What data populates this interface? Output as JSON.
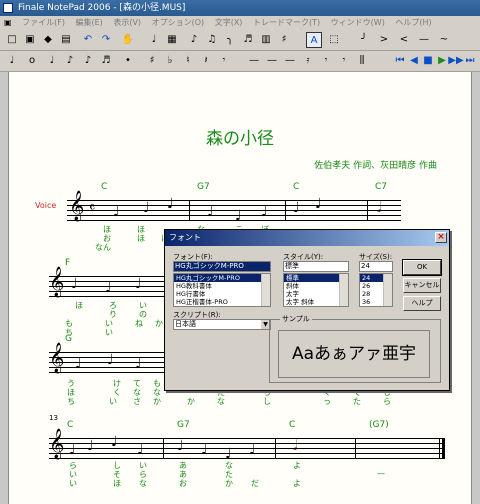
{
  "window": {
    "title": "Finale NotePad 2006 - [森の小径.MUS]"
  },
  "menu": [
    "ファイル(F)",
    "編集(E)",
    "表示(V)",
    "オプション(O)",
    "文字(X)",
    "トレードマーク(T)",
    "ウィンドウ(W)",
    "ヘルプ(H)"
  ],
  "toolbar1": [
    "□",
    "▣",
    "◆",
    "▤",
    "↶",
    "↷",
    "✋",
    "♩",
    "▦",
    "♪",
    "♫",
    "╮",
    "♬",
    "▥",
    "♯",
    "A",
    "⬚",
    "╯",
    ">",
    "<",
    "—",
    "~"
  ],
  "toolbar2": [
    "♩",
    "o",
    "♩",
    "♪",
    "♪",
    "♬",
    "•",
    "♯",
    "♭",
    "♮",
    "𝄽",
    "𝄾",
    "—",
    "—",
    "—",
    "𝄿",
    "𝄾",
    "𝄾",
    "⫼",
    "⏮",
    "◀",
    "■",
    "▶",
    "▶▶",
    "⏭"
  ],
  "score": {
    "title": "森の小径",
    "composer": "佐伯孝夫 作詞、灰田晴彦 作曲",
    "staff_name": "Voice",
    "chords_row1": [
      "C",
      "G7",
      "C",
      "C7"
    ],
    "lyrics_row1_a": [
      "ほ",
      "ほ",
      "な",
      "こ",
      "ぼ"
    ],
    "lyrics_row1_b": [
      "お",
      "ほ",
      "に"
    ],
    "lyrics_row1_c": [
      "なん"
    ],
    "chords_row2": [
      "F"
    ],
    "lyrics_row2_a": [
      "ほ",
      "ろ",
      "い"
    ],
    "lyrics_row2_b": [
      "り",
      "の"
    ],
    "lyrics_row2_c": [
      "も",
      "い",
      "ね",
      "か"
    ],
    "lyrics_row2_d": [
      "ち",
      "い"
    ],
    "chords_row3": [
      "G"
    ],
    "lyrics_row3_a": [
      "う",
      "け",
      "て",
      "も",
      "ら",
      "あ",
      "あ"
    ],
    "lyrics_row3_b": [
      "ほ",
      "く",
      "な",
      "な",
      "た",
      "ち",
      "く",
      "て",
      "し"
    ],
    "lyrics_row3_c": [
      "ち",
      "い",
      "さ",
      "か",
      "か",
      "な",
      "し",
      "っ",
      "た",
      "ら"
    ],
    "measure_num": "13",
    "chords_row4": [
      "C",
      "G7",
      "C",
      "(G7)"
    ],
    "lyrics_row4_a": [
      "ら",
      "し",
      "い",
      "あ",
      "な",
      "よ"
    ],
    "lyrics_row4_b": [
      "い",
      "そ",
      "ら",
      "あ",
      "た",
      "—"
    ],
    "lyrics_row4_c": [
      "い",
      "ほ",
      "な",
      "お",
      "か",
      "だ",
      "よ"
    ]
  },
  "font_dialog": {
    "title": "フォント",
    "font_label": "フォント(F):",
    "font_value": "HG丸ゴシックM-PRO",
    "font_list": [
      "HG丸ゴシックM-PRO",
      "HG教科書体",
      "HG行書体",
      "HG正楷書体-PRO"
    ],
    "style_label": "スタイル(Y):",
    "style_value": "標準",
    "style_list": [
      "標準",
      "斜体",
      "太字",
      "太字 斜体"
    ],
    "size_label": "サイズ(S):",
    "size_value": "24",
    "size_list": [
      "24",
      "26",
      "28",
      "36"
    ],
    "ok_label": "OK",
    "cancel_label": "キャンセル",
    "help_label": "ヘルプ",
    "script_label": "スクリプト(R):",
    "script_value": "日本語",
    "sample_label": "サンプル",
    "sample_text": "Aaあぁアァ亜宇"
  }
}
